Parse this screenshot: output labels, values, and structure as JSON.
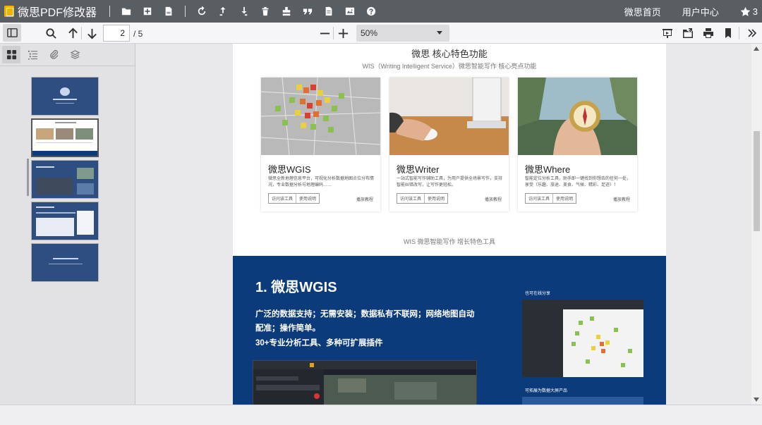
{
  "app": {
    "title": "微思PDF修改器"
  },
  "titlebar": {
    "icons": [
      "folder-open-icon",
      "add-icon",
      "file-icon",
      "refresh-icon",
      "upload-icon",
      "download-icon",
      "delete-icon",
      "stamp-icon",
      "quote-icon",
      "document-icon",
      "image-icon",
      "help-icon"
    ],
    "links": [
      "微思首页",
      "用户中心"
    ],
    "star_count": "3"
  },
  "toolbar": {
    "page_current": "2",
    "page_total": "/ 5",
    "zoom": "50%",
    "right_icons": [
      "presentation-icon",
      "open-file-icon",
      "print-icon",
      "bookmark-icon",
      "more-icon"
    ]
  },
  "sidebar": {
    "tabs": [
      "thumbnails-icon",
      "outline-icon",
      "attachments-icon",
      "layers-icon"
    ],
    "active_tab": "thumbnails",
    "selected_page": 2,
    "page_count": 5
  },
  "document": {
    "section_title": "微思 核心特色功能",
    "section_subtitle": "WIS（Writing Intelligent Service）微思智能写作 核心亮点功能",
    "cards": [
      {
        "title": "微思WGIS",
        "desc": "微思全新地理信息平台，可视化分析数据地图点位分布情况，专业数据分析与地理编码……",
        "btn1": "访问该工具",
        "btn2": "使用说明",
        "more": "播放教程"
      },
      {
        "title": "微思Writer",
        "desc": "一站式智能写作辅助工具，为用户提供全场景写作，支持智能纠错改写，让写作更轻松。",
        "btn1": "访问该工具",
        "btn2": "使用说明",
        "more": "播放教程"
      },
      {
        "title": "微思Where",
        "desc": "智能定位分析工具，助手即一键找到你想去的任何一处，享受（乐趣、旅途、美食、气候、精彩、足迹）！",
        "btn1": "访问该工具",
        "btn2": "使用说明",
        "more": "播放教程"
      }
    ],
    "mid_caption": "WIS 微思智能写作 增长特色工具",
    "wgis": {
      "heading": "1. 微思WGIS",
      "para1": "广泛的数据支持；无需安装；数据私有不联网；网络地图自动配准；操作简单。",
      "para2": "30+专业分析工具、多种可扩展插件",
      "cap_online": "也可在线分享",
      "cap_data": "可拓展为数据大屏产品"
    }
  },
  "colors": {
    "titlebar": "#595e63",
    "blue_section": "#0b3b7a",
    "logo": "#f6b000"
  }
}
